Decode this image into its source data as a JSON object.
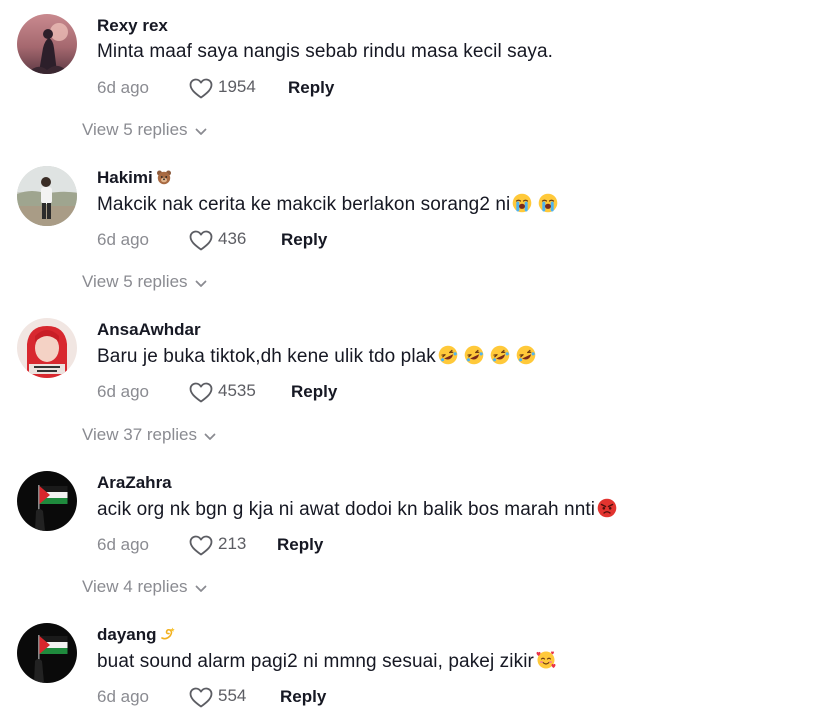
{
  "comments": [
    {
      "username": "Rexy rex",
      "text": "Minta maaf saya nangis sebab rindu masa kecil saya.",
      "date": "6d ago",
      "likes": "1954",
      "reply_label": "Reply",
      "view_replies": "View 5 replies"
    },
    {
      "username": "Hakimi",
      "username_icon": "bear-face-icon",
      "text": "Makcik nak cerita ke makcik berlakon sorang2 ni",
      "text_icons": [
        "loudly-crying-face-icon",
        "loudly-crying-face-icon"
      ],
      "date": "6d ago",
      "likes": "436",
      "reply_label": "Reply",
      "view_replies": "View 5 replies"
    },
    {
      "username": "AnsaAwhdar",
      "text": "Baru je buka tiktok,dh kene ulik tdo plak",
      "text_icons": [
        "rolling-on-floor-laughing-icon",
        "rolling-on-floor-laughing-icon",
        "rolling-on-floor-laughing-icon",
        "rolling-on-floor-laughing-icon"
      ],
      "date": "6d ago",
      "likes": "4535",
      "reply_label": "Reply",
      "view_replies": "View 37 replies"
    },
    {
      "username": "AraZahra",
      "text": "acik org nk bgn g kja ni awat dodoi kn balik bos marah nnti",
      "text_icons": [
        "angry-face-icon"
      ],
      "date": "6d ago",
      "likes": "213",
      "reply_label": "Reply",
      "view_replies": "View 4 replies"
    },
    {
      "username": "dayang",
      "username_icon": "dizzy-icon",
      "text": "buat sound alarm pagi2 ni mmng sesuai, pakej zikir",
      "text_icons": [
        "smiling-face-with-hearts-icon"
      ],
      "date": "6d ago",
      "likes": "554",
      "reply_label": "Reply"
    }
  ],
  "colors": {
    "text_primary": "#161823",
    "text_secondary": "#8a8b91",
    "like_count": "#5c5d63",
    "background": "#ffffff"
  }
}
